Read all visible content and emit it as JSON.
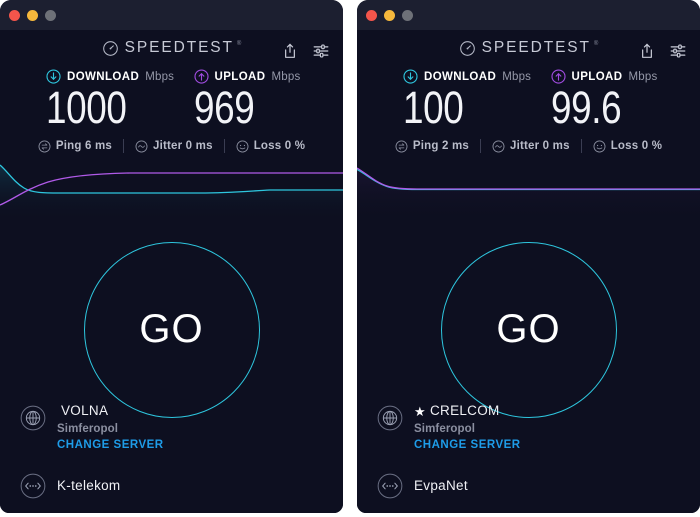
{
  "windows": [
    {
      "id": "left",
      "titlebar": {
        "close_label": "close",
        "minimize_label": "minimize",
        "maximize_label": "maximize"
      },
      "brand": {
        "name": "SPEEDTEST",
        "trademark": "®",
        "icon": "speedometer-icon"
      },
      "actions": {
        "share": "share-icon",
        "settings": "settings-sliders-icon"
      },
      "download": {
        "icon": "download-arrow-icon",
        "label": "DOWNLOAD",
        "unit": "Mbps",
        "value": "1000",
        "color": "#2ec6de"
      },
      "upload": {
        "icon": "upload-arrow-icon",
        "label": "UPLOAD",
        "unit": "Mbps",
        "value": "969",
        "color": "#a04ce0"
      },
      "stats": [
        {
          "icon": "ping-icon",
          "text": "Ping 6 ms"
        },
        {
          "icon": "jitter-icon",
          "text": "Jitter 0 ms"
        },
        {
          "icon": "loss-icon",
          "text": "Loss 0 %"
        }
      ],
      "go": {
        "label": "GO"
      },
      "server": {
        "icon": "globe-icon",
        "starred": false,
        "star": "",
        "name": "VOLNA",
        "city": "Simferopol",
        "change_label": "CHANGE SERVER"
      },
      "isp": {
        "icon": "connection-icon",
        "name": "K-telekom"
      },
      "chart_data": {
        "type": "line",
        "title": "",
        "xlabel": "",
        "ylabel": "",
        "grid": false,
        "legend": "none",
        "ylim": [
          0,
          1
        ],
        "x": [
          0,
          0.04,
          0.09,
          0.14,
          0.2,
          0.3,
          0.45,
          0.62,
          0.8,
          1.0
        ],
        "series": [
          {
            "name": "download",
            "color": "#2ec6de",
            "values": [
              0.92,
              0.74,
              0.52,
              0.4,
              0.38,
              0.38,
              0.38,
              0.4,
              0.4,
              0.4
            ]
          },
          {
            "name": "upload",
            "color": "#b05ae8",
            "values": [
              0.1,
              0.22,
              0.4,
              0.54,
              0.64,
              0.7,
              0.72,
              0.72,
              0.72,
              0.72
            ]
          }
        ]
      }
    },
    {
      "id": "right",
      "titlebar": {
        "close_label": "close",
        "minimize_label": "minimize",
        "maximize_label": "maximize"
      },
      "brand": {
        "name": "SPEEDTEST",
        "trademark": "®",
        "icon": "speedometer-icon"
      },
      "actions": {
        "share": "share-icon",
        "settings": "settings-sliders-icon"
      },
      "download": {
        "icon": "download-arrow-icon",
        "label": "DOWNLOAD",
        "unit": "Mbps",
        "value": "100",
        "color": "#2ec6de"
      },
      "upload": {
        "icon": "upload-arrow-icon",
        "label": "UPLOAD",
        "unit": "Mbps",
        "value": "99.6",
        "color": "#a04ce0"
      },
      "stats": [
        {
          "icon": "ping-icon",
          "text": "Ping 2 ms"
        },
        {
          "icon": "jitter-icon",
          "text": "Jitter 0 ms"
        },
        {
          "icon": "loss-icon",
          "text": "Loss 0 %"
        }
      ],
      "go": {
        "label": "GO"
      },
      "server": {
        "icon": "globe-icon",
        "starred": true,
        "star": "★",
        "name": "CRELCOM",
        "city": "Simferopol",
        "change_label": "CHANGE SERVER"
      },
      "isp": {
        "icon": "connection-icon",
        "name": "EvpaNet"
      },
      "chart_data": {
        "type": "line",
        "title": "",
        "xlabel": "",
        "ylabel": "",
        "grid": false,
        "legend": "none",
        "ylim": [
          0,
          1
        ],
        "x": [
          0,
          0.04,
          0.09,
          0.14,
          0.2,
          0.3,
          0.45,
          0.62,
          0.8,
          1.0
        ],
        "series": [
          {
            "name": "download",
            "color": "#2ec6de",
            "values": [
              0.86,
              0.7,
              0.52,
              0.46,
              0.45,
              0.45,
              0.45,
              0.45,
              0.45,
              0.45
            ]
          },
          {
            "name": "upload",
            "color": "#b05ae8",
            "values": [
              0.88,
              0.72,
              0.53,
              0.46,
              0.45,
              0.45,
              0.45,
              0.45,
              0.45,
              0.45
            ]
          }
        ]
      }
    }
  ],
  "colors": {
    "background": "#0d0f20",
    "titlebar": "#1c1f30",
    "accent_download": "#2ec6de",
    "accent_upload": "#a04ce0",
    "link": "#1e9ce8",
    "desktop": "#ffffff"
  }
}
